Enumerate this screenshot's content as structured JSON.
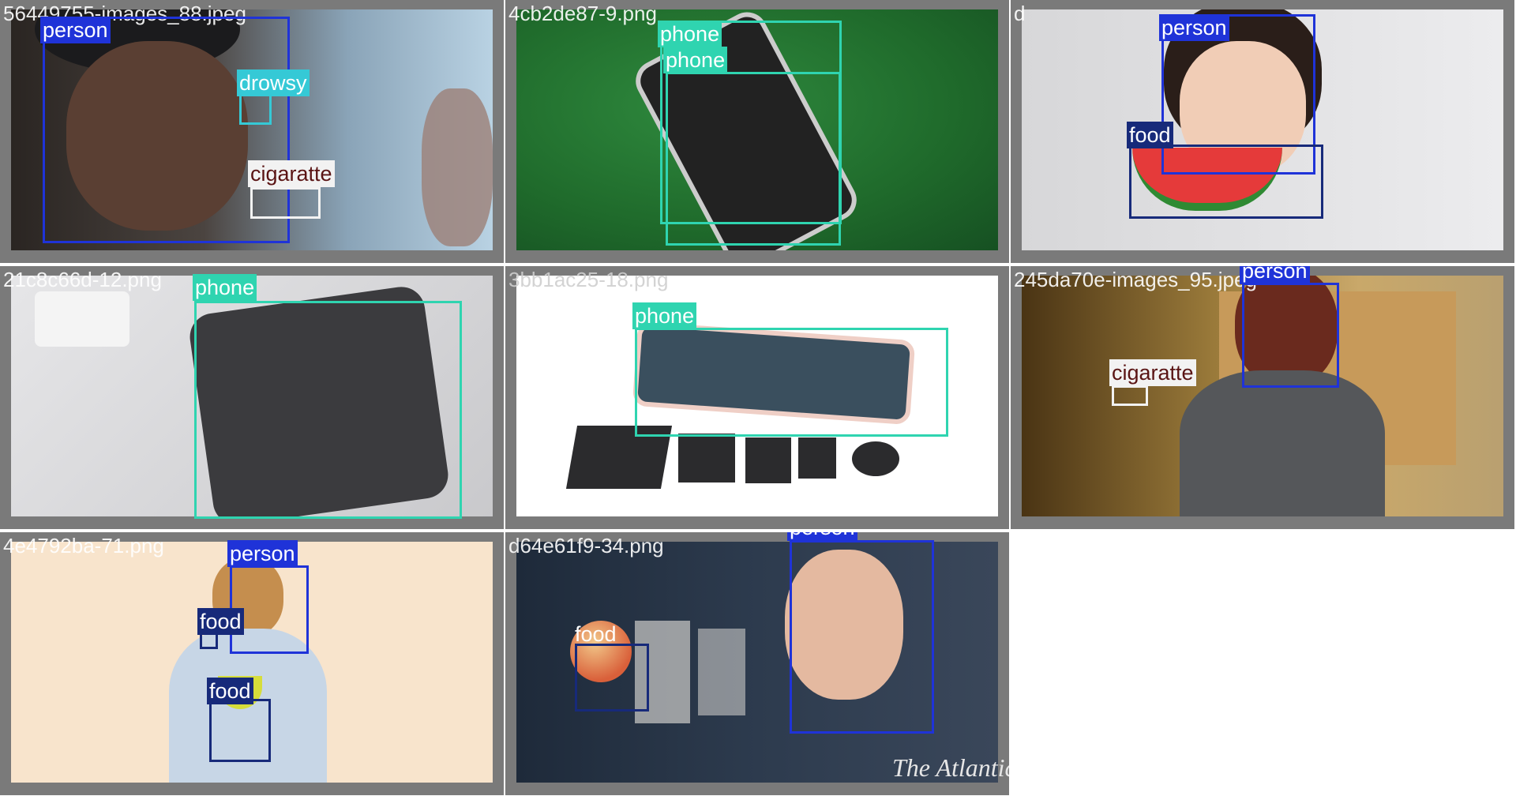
{
  "tiles": [
    {
      "filename": "56449755-images_88.jpeg",
      "labels": [
        "person",
        "drowsy",
        "cigaratte"
      ]
    },
    {
      "filename": "4cb2de87-9.png",
      "labels": [
        "phone",
        "phone"
      ]
    },
    {
      "filename": "d",
      "labels": [
        "person",
        "food"
      ]
    },
    {
      "filename": "21c8c66d-12.png",
      "labels": [
        "phone"
      ]
    },
    {
      "filename": "3bb1ac25-18.png",
      "labels": [
        "phone"
      ]
    },
    {
      "filename": "245da70e-images_95.jpeg",
      "labels": [
        "person",
        "cigaratte"
      ]
    },
    {
      "filename": "4e4792ba-71.png",
      "labels": [
        "person",
        "food",
        "food"
      ]
    },
    {
      "filename": "d64e61f9-34.png",
      "labels": [
        "person",
        "food"
      ]
    }
  ],
  "watermark": "The Atlantic",
  "colors": {
    "person": "#1f33d8",
    "phone": "#2fd4b0",
    "drowsy": "#35c9d6",
    "food": "#172a7a",
    "cigaratte": "#f2f2f2",
    "tile_border": "#7a7a7a"
  }
}
